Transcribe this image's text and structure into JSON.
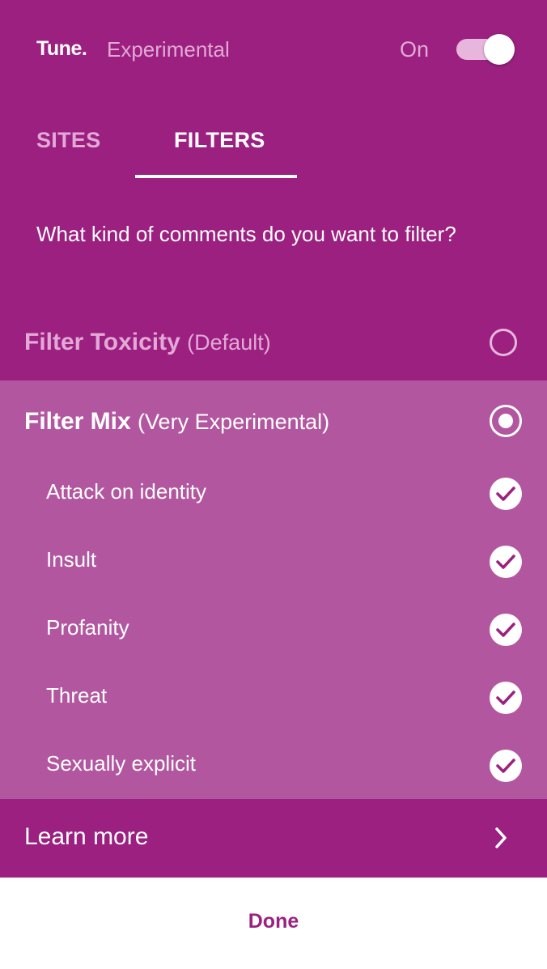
{
  "header": {
    "brand": "Tune.",
    "subtitle": "Experimental",
    "toggle_label": "On",
    "toggle_on": true
  },
  "tabs": [
    {
      "label": "SITES",
      "active": false
    },
    {
      "label": "FILTERS",
      "active": true
    }
  ],
  "question": "What kind of comments do you want to filter?",
  "options": {
    "toxicity": {
      "title": "Filter Toxicity",
      "note": "(Default)",
      "selected": false
    },
    "mix": {
      "title": "Filter Mix",
      "note": "(Very Experimental)",
      "selected": true,
      "filters": [
        {
          "label": "Attack on identity",
          "checked": true
        },
        {
          "label": "Insult",
          "checked": true
        },
        {
          "label": "Profanity",
          "checked": true
        },
        {
          "label": "Threat",
          "checked": true
        },
        {
          "label": "Sexually explicit",
          "checked": true
        }
      ]
    }
  },
  "learn_more": "Learn more",
  "done": "Done",
  "colors": {
    "primary": "#9b2080",
    "section": "#b2579f",
    "muted_text": "#e3a9d6"
  }
}
